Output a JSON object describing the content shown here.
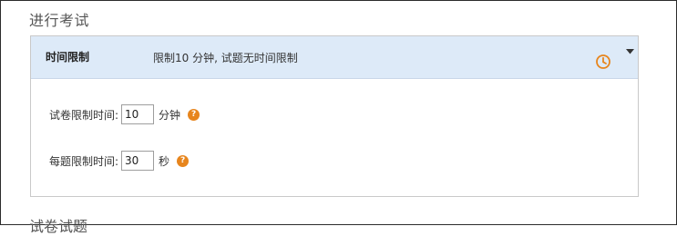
{
  "section": {
    "title": "进行考试"
  },
  "panel": {
    "title": "时间限制",
    "description": "限制10 分钟, 试题无时间限制",
    "icons": {
      "clock": "clock-icon",
      "toggle": "caret-down-icon"
    },
    "accent_color": "#e7851d",
    "header_bg": "#ddeaf8"
  },
  "form": {
    "paper_limit": {
      "label": "试卷限制时间:",
      "value": "10",
      "unit": "分钟",
      "help": "?"
    },
    "question_limit": {
      "label": "每题限制时间:",
      "value": "30",
      "unit": "秒",
      "help": "?"
    }
  },
  "next_section": {
    "title": "试卷试题"
  }
}
